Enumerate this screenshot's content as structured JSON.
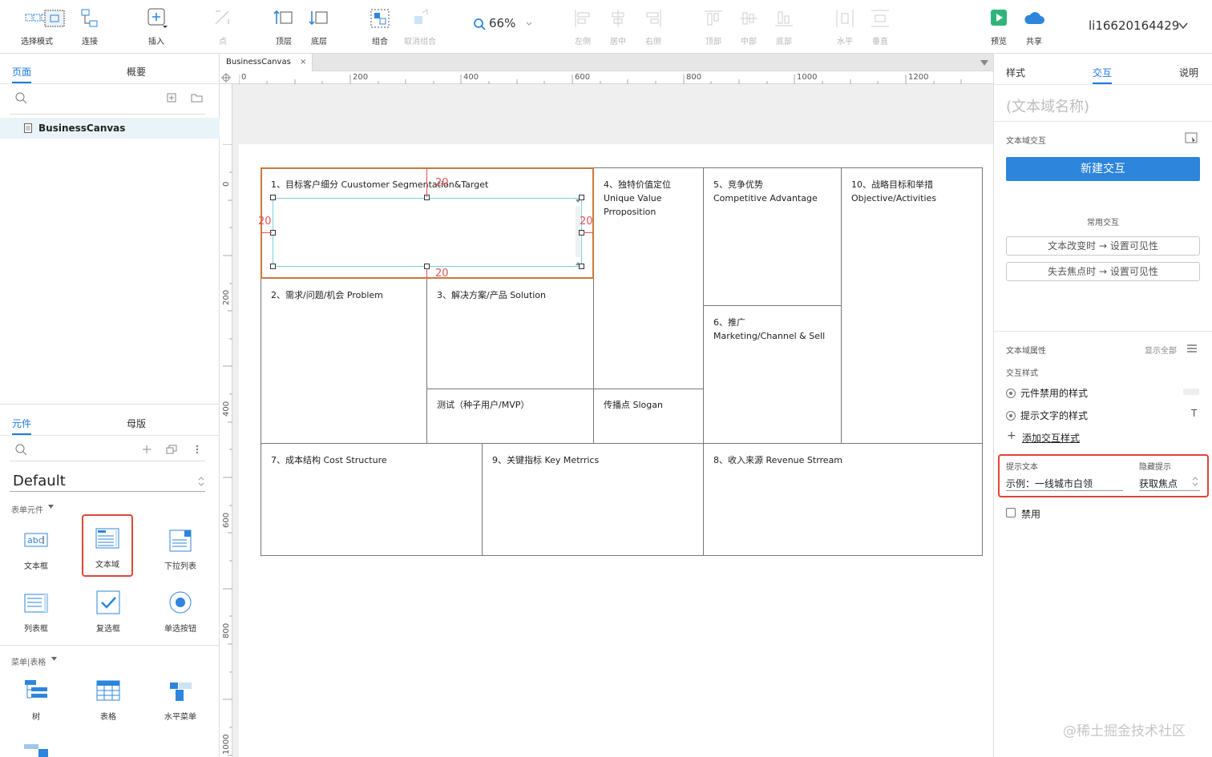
{
  "toolbar": {
    "select_mode": "选择模式",
    "connect": "连接",
    "insert": "插入",
    "point": "点",
    "top_layer": "顶层",
    "bottom_layer": "底层",
    "group": "组合",
    "ungroup": "取消组合",
    "zoom": "66%",
    "align_left": "左侧",
    "align_center": "居中",
    "align_right": "右侧",
    "align_top": "顶部",
    "align_middle": "中部",
    "align_bottom": "底部",
    "distribute_h": "水平",
    "distribute_v": "垂直",
    "preview": "预览",
    "share": "共享",
    "user": "li16620164429"
  },
  "left": {
    "tab_pages": "页面",
    "tab_outline": "概要",
    "page_name": "BusinessCanvas",
    "tab_widgets": "元件",
    "tab_masters": "母版",
    "library": "Default",
    "cat_form": "表单元件",
    "cat_menu": "菜单|表格",
    "widgets": [
      {
        "label": "文本框",
        "icon": "textbox-icon"
      },
      {
        "label": "文本域",
        "icon": "textarea-icon"
      },
      {
        "label": "下拉列表",
        "icon": "dropdown-icon"
      },
      {
        "label": "列表框",
        "icon": "listbox-icon"
      },
      {
        "label": "复选框",
        "icon": "checkbox-icon"
      },
      {
        "label": "单选按钮",
        "icon": "radio-icon"
      }
    ],
    "menu_widgets": [
      {
        "label": "树",
        "icon": "tree-icon"
      },
      {
        "label": "表格",
        "icon": "table-icon"
      },
      {
        "label": "水平菜单",
        "icon": "hmenu-icon"
      }
    ]
  },
  "canvas": {
    "tab": "BusinessCanvas",
    "tab_close": "×",
    "ruler_h": [
      "0",
      "200",
      "400",
      "600",
      "800",
      "1000",
      "1200"
    ],
    "ruler_v": [
      "0",
      "200",
      "400",
      "600",
      "800",
      "1000"
    ],
    "cells": {
      "c1": "1、目标客户细分 Cuustomer Segmentation&Target",
      "c2": "2、需求/问题/机会 Problem",
      "c3": "3、解决方案/产品 Solution",
      "c4": "4、独特价值定位\nUnique Value\nPrroposition",
      "c5": "5、竞争优势\nCompetitive Advantage",
      "c6": "6、推广\nMarketing/Channel & Sell",
      "c7": "7、成本结构 Cost Structure",
      "c8": "8、收入来源 Revenue Strream",
      "c9": "9、关键指标 Key Metrrics",
      "c10": "10、战略目标和举措\nObjective/Activities",
      "test": "测试（种子用户/MVP）",
      "slogan": "传播点 Slogan"
    },
    "measure_top": "20",
    "measure_left": "20",
    "measure_right": "20",
    "measure_bottom": "20"
  },
  "right": {
    "tab_style": "样式",
    "tab_interaction": "交互",
    "tab_notes": "说明",
    "name_placeholder": "(文本域名称)",
    "textarea_interaction": "文本域交互",
    "new_interaction": "新建交互",
    "common_interactions": "常用交互",
    "quick1": "文本改变时 → 设置可见性",
    "quick2": "失去焦点时 → 设置可见性",
    "props_title": "文本域属性",
    "show_all": "显示全部",
    "inter_style": "交互样式",
    "disabled_style": "元件禁用的样式",
    "hint_style": "提示文字的样式",
    "add_style": "添加交互样式",
    "hint_text_label": "提示文本",
    "hint_text_value": "示例：一线城市白领",
    "hide_hint_label": "隐藏提示",
    "hide_hint_value": "获取焦点",
    "disabled": "禁用"
  },
  "watermark": "@稀土掘金技术社区",
  "colors": {
    "accent": "#1a7ae0",
    "highlight": "#e0453a",
    "button": "#2d85dc"
  }
}
